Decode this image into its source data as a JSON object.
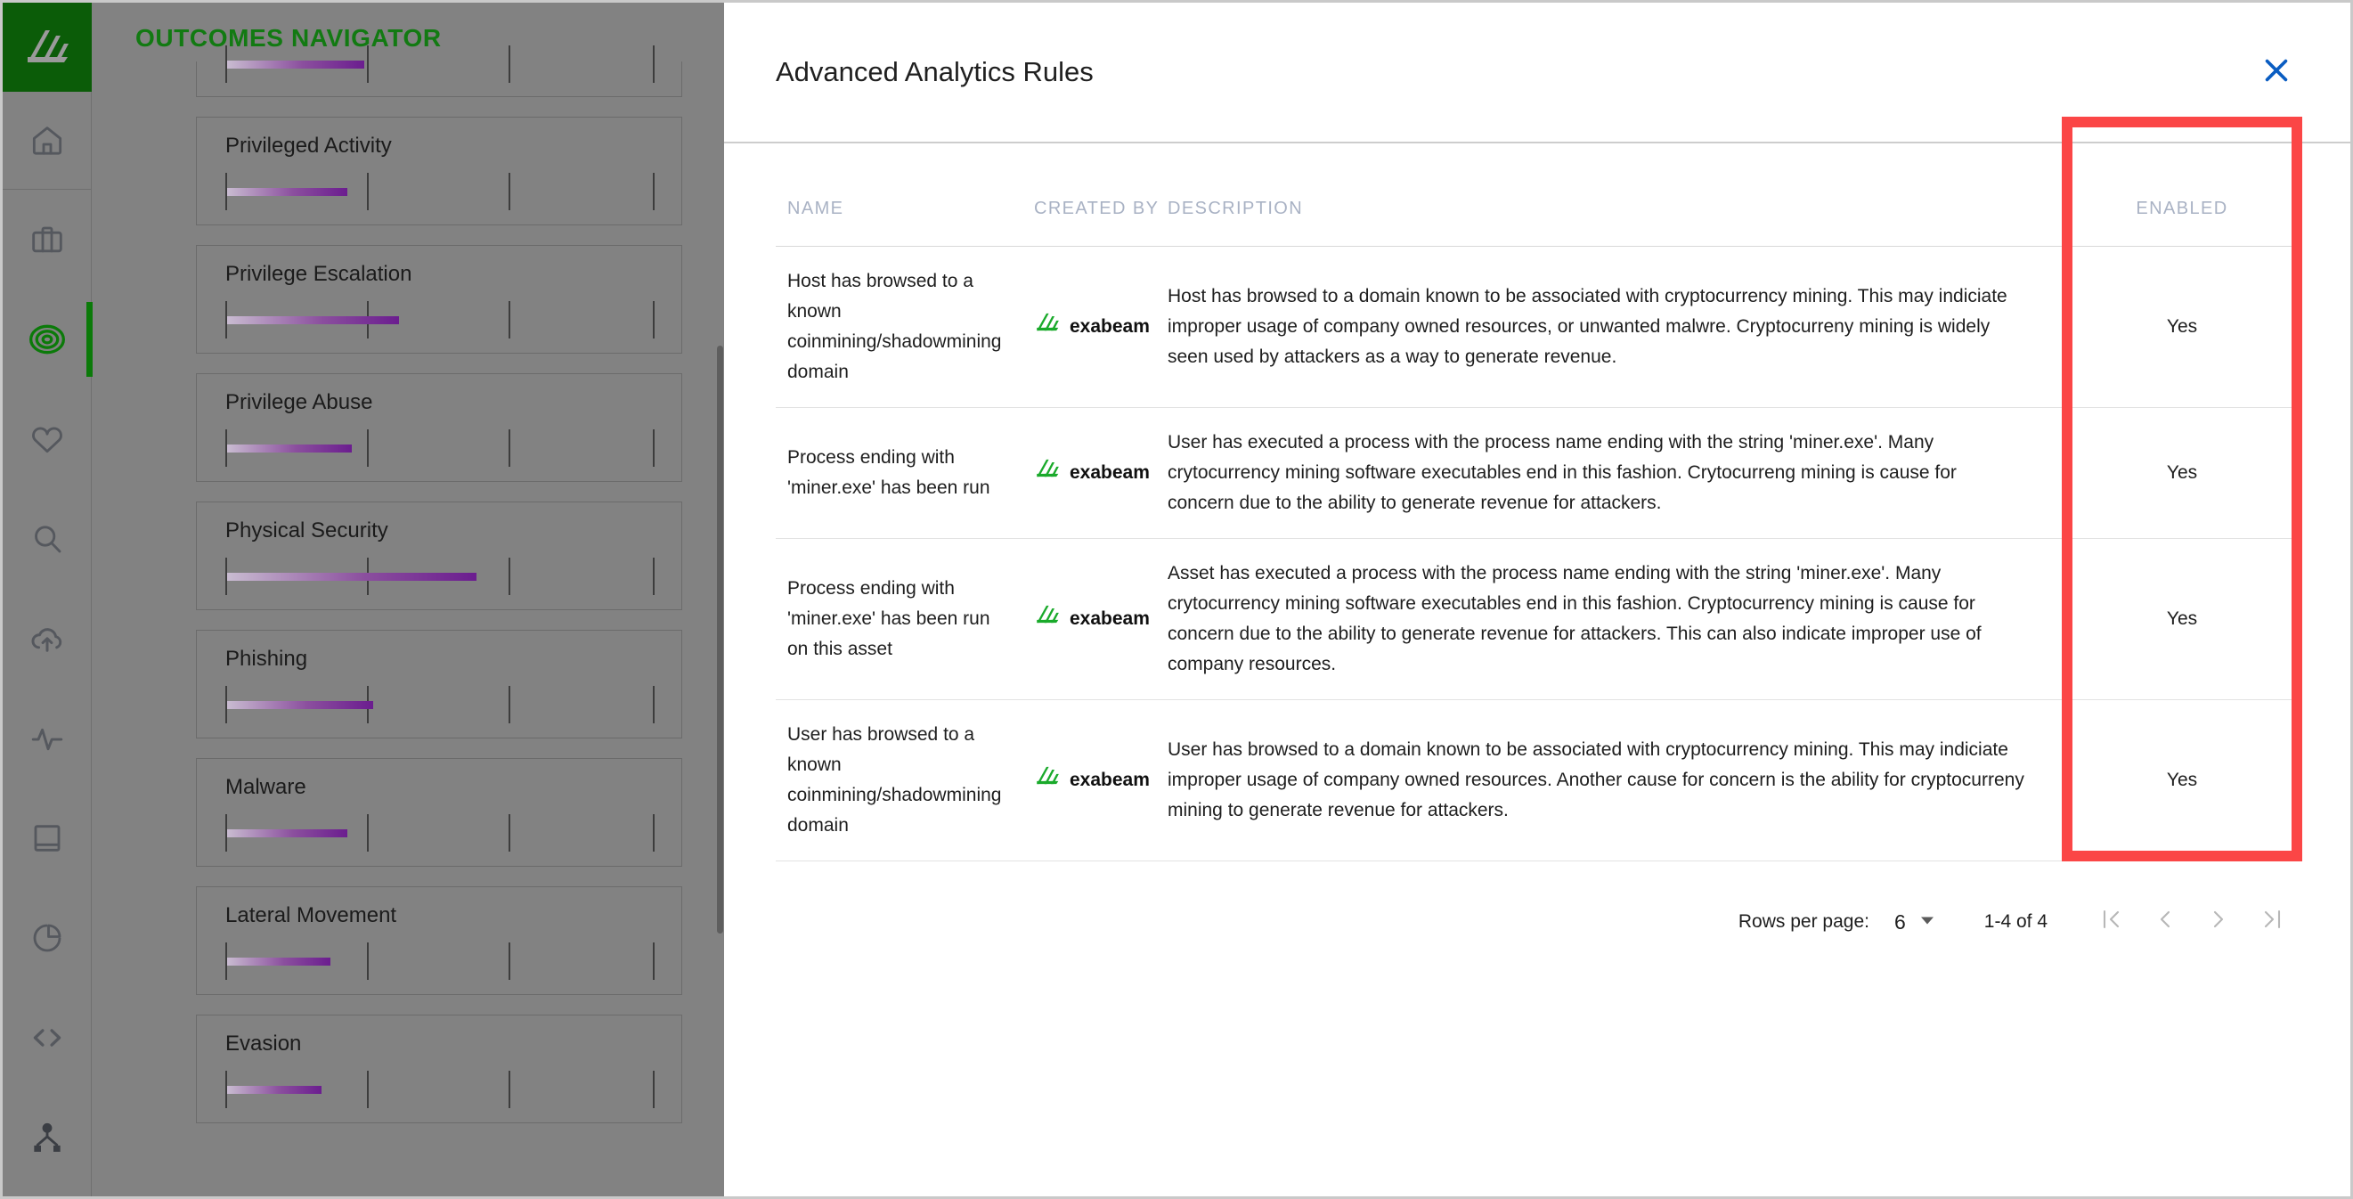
{
  "app": {
    "brand_logo_icon": "exabeam-mark-icon",
    "panel_title": "OUTCOMES NAVIGATOR",
    "accent_green": "#127a12",
    "panel_bg": "#828282",
    "meter_gradient_start": "#c9bcd1",
    "meter_gradient_end": "#6b1d8f"
  },
  "rail": {
    "items": [
      {
        "icon": "home-icon",
        "name": "sidebar-item-home",
        "active": false
      },
      {
        "icon": "briefcase-icon",
        "name": "sidebar-item-cases",
        "active": false
      },
      {
        "icon": "target-icon",
        "name": "sidebar-item-outcomes",
        "active": true
      },
      {
        "icon": "heart-icon",
        "name": "sidebar-item-health",
        "active": false
      },
      {
        "icon": "search-icon",
        "name": "sidebar-item-search",
        "active": false
      },
      {
        "icon": "cloud-upload-icon",
        "name": "sidebar-item-ingest",
        "active": false
      },
      {
        "icon": "pulse-icon",
        "name": "sidebar-item-activity",
        "active": false
      },
      {
        "icon": "book-icon",
        "name": "sidebar-item-library",
        "active": false
      },
      {
        "icon": "pie-chart-icon",
        "name": "sidebar-item-reports",
        "active": false
      },
      {
        "icon": "code-icon",
        "name": "sidebar-item-developer",
        "active": false
      },
      {
        "icon": "sitemap-icon",
        "name": "sidebar-item-topology",
        "active": false
      }
    ]
  },
  "outcomes": {
    "cards": [
      {
        "label": "Privileged Activity",
        "progress": 28
      },
      {
        "label": "Privilege Escalation",
        "progress": 40
      },
      {
        "label": "Privilege Abuse",
        "progress": 29
      },
      {
        "label": "Physical Security",
        "progress": 58
      },
      {
        "label": "Phishing",
        "progress": 34
      },
      {
        "label": "Malware",
        "progress": 28
      },
      {
        "label": "Lateral Movement",
        "progress": 24
      },
      {
        "label": "Evasion",
        "progress": 22
      }
    ]
  },
  "modal": {
    "title": "Advanced Analytics Rules",
    "close_icon": "close-icon",
    "close_color": "#0a5dc2",
    "highlight_color": "#fb4646",
    "columns": [
      "NAME",
      "CREATED BY",
      "DESCRIPTION",
      "ENABLED"
    ],
    "rows": [
      {
        "name": "Host has browsed to a known coinmining/shadowmining domain",
        "created_by": "exabeam",
        "description": "Host has browsed to a domain known to be associated with cryptocurrency mining. This may indiciate improper usage of company owned resources, or unwanted malwre. Cryptocurreny mining is widely seen used by attackers as a way to generate revenue.",
        "enabled": "Yes"
      },
      {
        "name": "Process ending with 'miner.exe' has been run",
        "created_by": "exabeam",
        "description": "User has executed a process with the process name ending with the string 'miner.exe'. Many crytocurrency mining software executables end in this fashion. Crytocurreng mining is cause for concern due to the ability to generate revenue for attackers.",
        "enabled": "Yes"
      },
      {
        "name": "Process ending with 'miner.exe' has been run on this asset",
        "created_by": "exabeam",
        "description": "Asset has executed a process with the process name ending with the string 'miner.exe'. Many crytocurrency mining software executables end in this fashion. Cryptocurrency mining is cause for concern due to the ability to generate revenue for attackers. This can also indicate improper use of company resources.",
        "enabled": "Yes"
      },
      {
        "name": "User has browsed to a known coinmining/shadowmining domain",
        "created_by": "exabeam",
        "description": "User has browsed to a domain known to be associated with cryptocurrency mining. This may indiciate improper usage of company owned resources. Another cause for concern is the ability for cryptocurreny mining to generate revenue for attackers.",
        "enabled": "Yes"
      }
    ]
  },
  "pagination": {
    "rows_per_page_label": "Rows per page:",
    "rows_per_page_value": "6",
    "range_label": "1-4 of 4",
    "first_page_icon": "first-page-icon",
    "prev_page_icon": "chevron-left-icon",
    "next_page_icon": "chevron-right-icon",
    "last_page_icon": "last-page-icon"
  }
}
